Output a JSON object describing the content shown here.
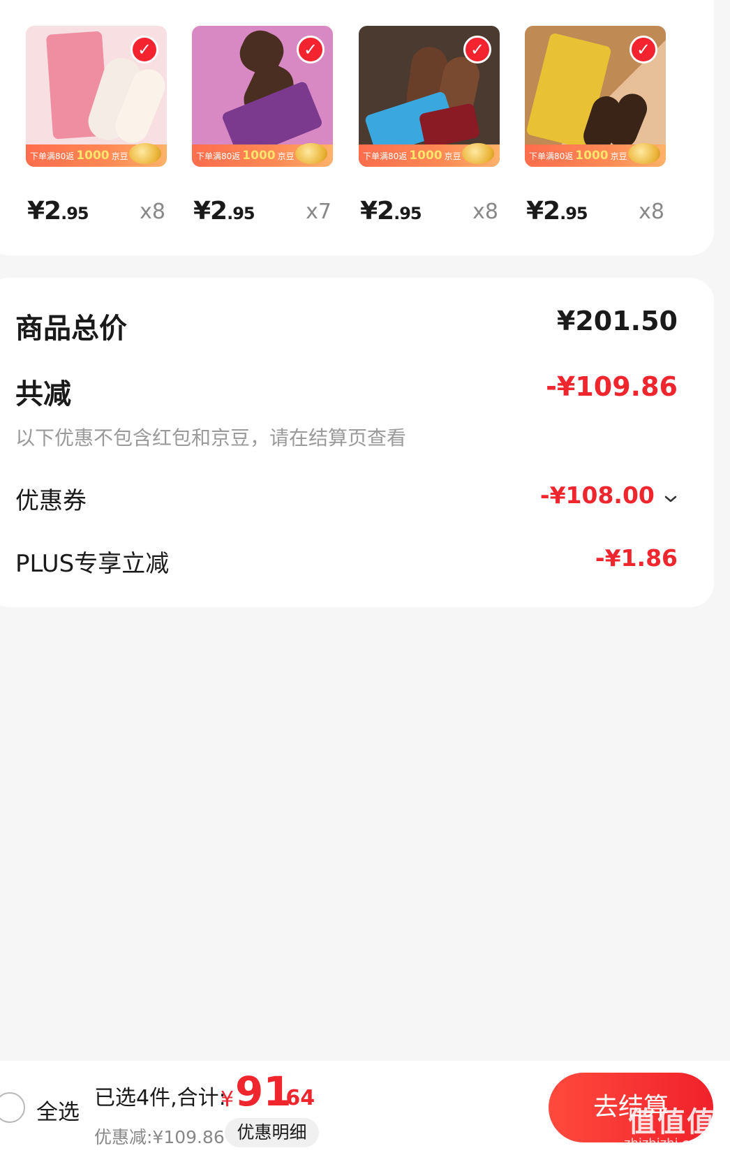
{
  "products": [
    {
      "name": "product-1",
      "price_int": "¥2",
      "price_dec": ".95",
      "qty": "x8",
      "banner_pre": "下单满80返",
      "banner_num": "1000",
      "banner_post": "京豆",
      "bg": "#f7dfe2",
      "accent": "#ef8ea0"
    },
    {
      "name": "product-2",
      "price_int": "¥2",
      "price_dec": ".95",
      "qty": "x7",
      "banner_pre": "下单满80返",
      "banner_num": "1000",
      "banner_post": "京豆",
      "bg": "#d889c4",
      "accent": "#7b3a8e"
    },
    {
      "name": "product-3",
      "price_int": "¥2",
      "price_dec": ".95",
      "qty": "x8",
      "banner_pre": "下单满80返",
      "banner_num": "1000",
      "banner_post": "京豆",
      "bg": "#4a3a30",
      "accent": "#3aa8df"
    },
    {
      "name": "product-4",
      "price_int": "¥2",
      "price_dec": ".95",
      "qty": "x8",
      "banner_pre": "下单满80返",
      "banner_num": "1000",
      "banner_post": "京豆",
      "bg": "#c89a64",
      "accent": "#e8c234"
    }
  ],
  "summary": {
    "total_label": "商品总价",
    "total_value": "¥201.50",
    "reduce_label": "共减",
    "reduce_value": "-¥109.86",
    "note": "以下优惠不包含红包和京豆，请在结算页查看",
    "coupon_label": "优惠券",
    "coupon_value": "-¥108.00",
    "plus_label": "PLUS专享立减",
    "plus_value": "-¥1.86"
  },
  "bottom": {
    "select_all": "全选",
    "selected": "已选4件,合计:",
    "total_symbol": "¥",
    "total_int": "91",
    "total_dec": ".64",
    "discount": "优惠减:¥109.86",
    "detail_button": "优惠明细",
    "checkout_button": "去结算"
  },
  "watermark": {
    "main": "值值值",
    "sub": "zhizhizhi.com"
  },
  "colors": {
    "accent_red": "#f0262f",
    "background": "#f6f6f6"
  }
}
